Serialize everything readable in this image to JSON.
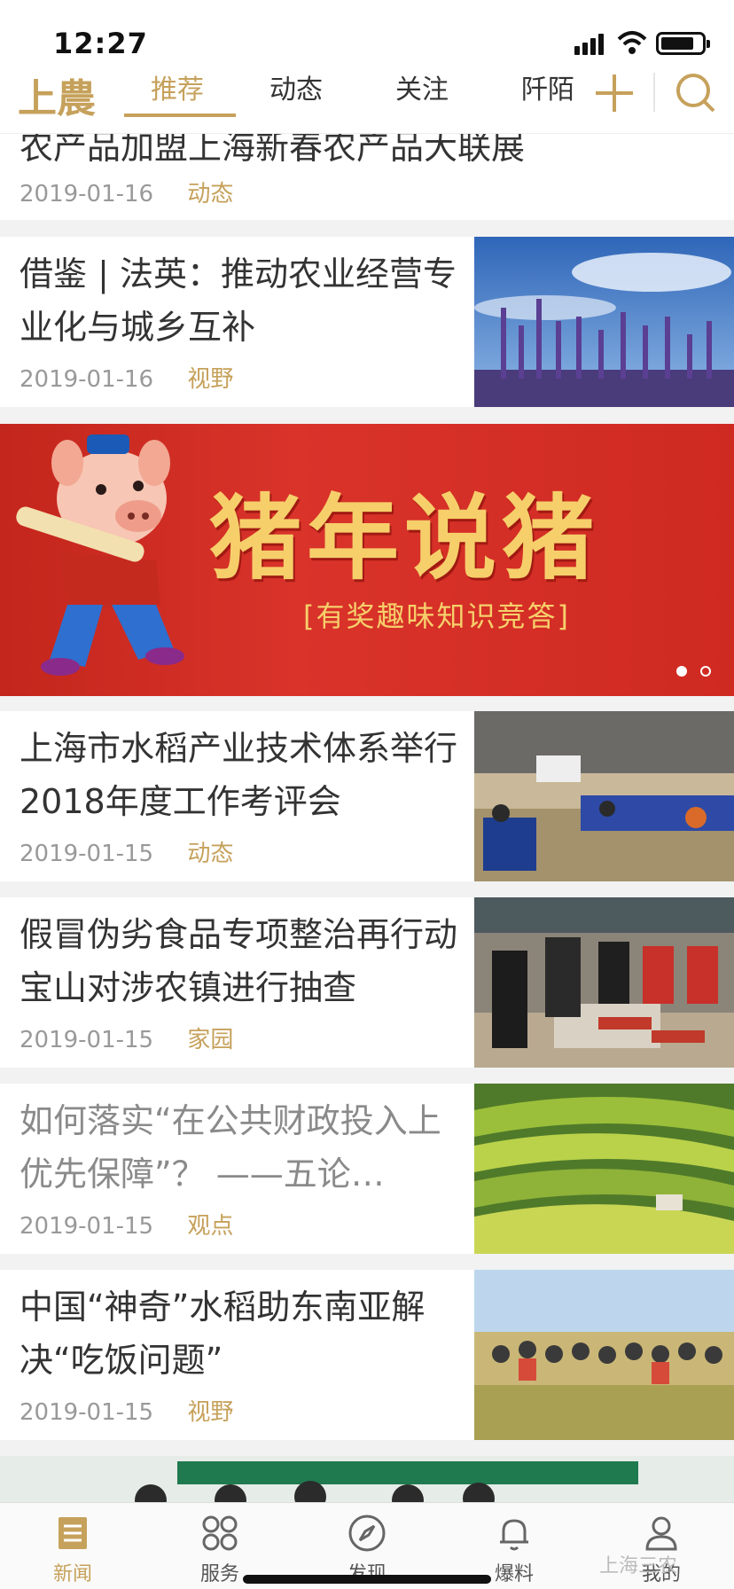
{
  "status_bar": {
    "time": "12:27"
  },
  "header": {
    "logo": "上農",
    "tabs": [
      {
        "label": "推荐",
        "active": true
      },
      {
        "label": "动态",
        "active": false
      },
      {
        "label": "关注",
        "active": false
      },
      {
        "label": "阡陌",
        "active": false
      }
    ]
  },
  "feed": {
    "items": [
      {
        "title": "农产品加盟上海新春农产品大联展",
        "date": "2019-01-16",
        "category": "动态"
      },
      {
        "title": "借鉴 | 法英：推动农业经营专业化与城乡互补",
        "date": "2019-01-16",
        "category": "视野",
        "image": "lavender-field"
      },
      {
        "title": "上海市水稻产业技术体系举行2018年度工作考评会",
        "date": "2019-01-15",
        "category": "动态",
        "image": "conference-room"
      },
      {
        "title": "假冒伪劣食品专项整治再行动 宝山对涉农镇进行抽查",
        "date": "2019-01-15",
        "category": "家园",
        "image": "market-inspection"
      },
      {
        "title": "如何落实“在公共财政投入上优先保障”？ ——五论…",
        "date": "2019-01-15",
        "category": "观点",
        "image": "rice-terraces"
      },
      {
        "title": "中国“神奇”水稻助东南亚解决“吃饭问题”",
        "date": "2019-01-15",
        "category": "视野",
        "image": "rice-field-group"
      }
    ]
  },
  "banner": {
    "title": "猪年说猪",
    "subtitle": "[有奖趣味知识竞答]",
    "pages": 2,
    "current_page": 1
  },
  "bottom_nav": {
    "items": [
      {
        "label": "新闻",
        "icon": "news-icon",
        "active": true
      },
      {
        "label": "服务",
        "icon": "grid-icon",
        "active": false
      },
      {
        "label": "发现",
        "icon": "compass-icon",
        "active": false
      },
      {
        "label": "爆料",
        "icon": "bell-icon",
        "active": false
      },
      {
        "label": "我的",
        "icon": "user-icon",
        "active": false
      }
    ]
  },
  "watermark": "上海三农",
  "colors": {
    "accent": "#c6a15b",
    "banner_red": "#d9332a",
    "banner_gold": "#f6cf6b"
  }
}
